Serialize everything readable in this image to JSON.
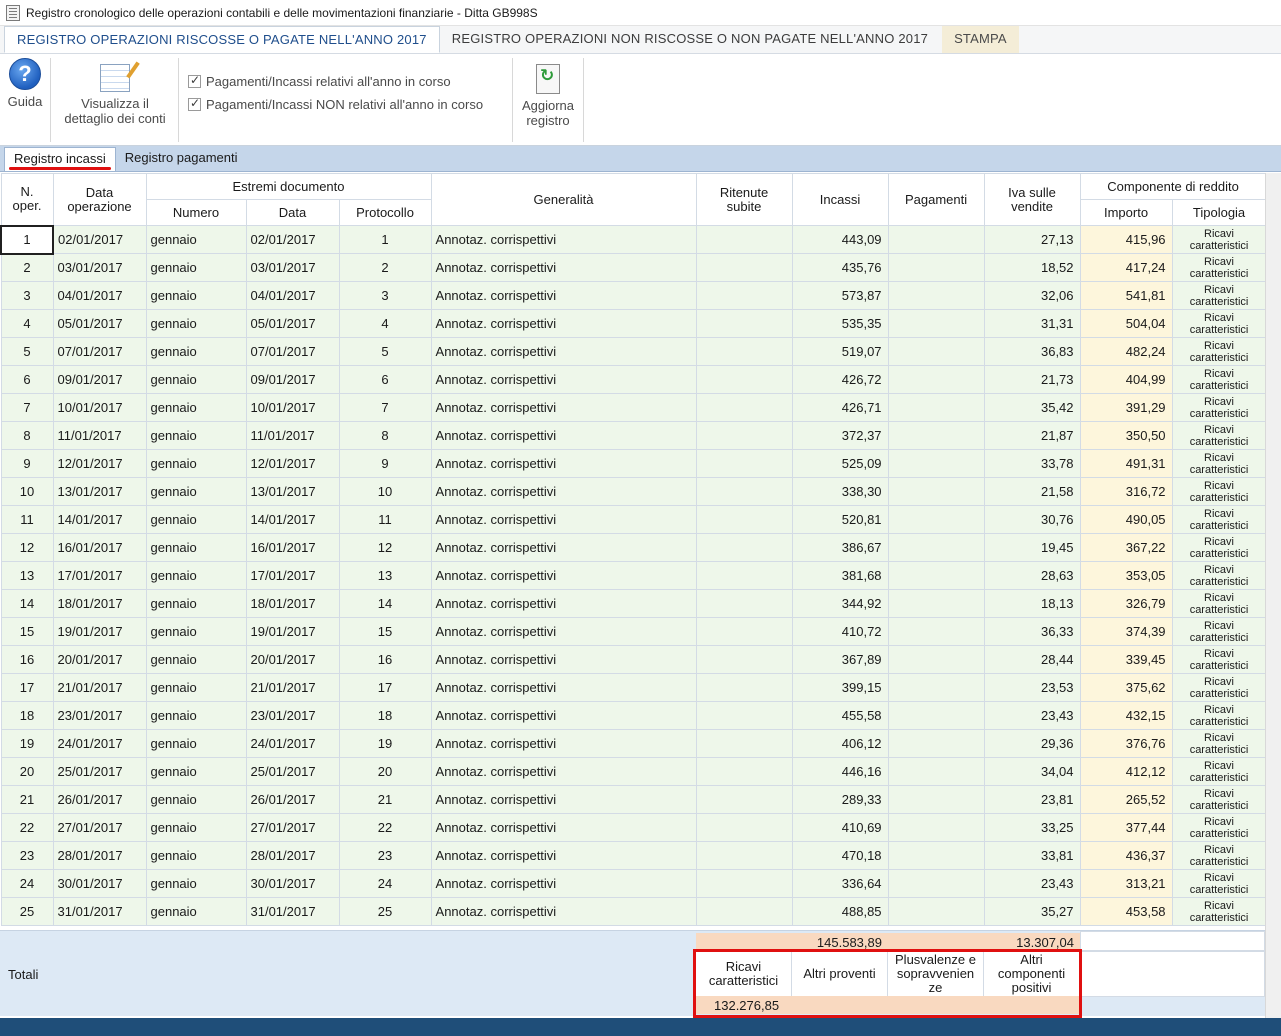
{
  "window": {
    "title": "Registro cronologico delle operazioni contabili e delle movimentazioni finanziarie - Ditta GB998S"
  },
  "ribbon": {
    "tabs": [
      {
        "label": "REGISTRO OPERAZIONI RISCOSSE O PAGATE NELL'ANNO 2017"
      },
      {
        "label": "REGISTRO OPERAZIONI NON RISCOSSE O NON PAGATE NELL'ANNO 2017"
      },
      {
        "label": "STAMPA"
      }
    ]
  },
  "toolbar": {
    "guida": "Guida",
    "visualizza_line1": "Visualizza il",
    "visualizza_line2": "dettaglio dei conti",
    "chk1": "Pagamenti/Incassi relativi all'anno in corso",
    "chk2": "Pagamenti/Incassi NON relativi all'anno in corso",
    "aggiorna_line1": "Aggiorna",
    "aggiorna_line2": "registro"
  },
  "subtabs": [
    {
      "label": "Registro incassi"
    },
    {
      "label": "Registro pagamenti"
    }
  ],
  "grid": {
    "headers": {
      "n_oper": "N.\noper.",
      "data_operazione": "Data\noperazione",
      "estremi": "Estremi documento",
      "numero": "Numero",
      "data": "Data",
      "protocollo": "Protocollo",
      "generalita": "Generalità",
      "ritenute": "Ritenute\nsubite",
      "incassi": "Incassi",
      "pagamenti": "Pagamenti",
      "iva": "Iva sulle\nvendite",
      "componente": "Componente di reddito",
      "importo": "Importo",
      "tipologia": "Tipologia"
    },
    "rows": [
      {
        "n": "1",
        "data_op": "02/01/2017",
        "numero": "gennaio",
        "data": "02/01/2017",
        "prot": "1",
        "gen": "Annotaz. corrispettivi",
        "incassi": "443,09",
        "iva": "27,13",
        "importo": "415,96",
        "tip": "Ricavi caratteristici"
      },
      {
        "n": "2",
        "data_op": "03/01/2017",
        "numero": "gennaio",
        "data": "03/01/2017",
        "prot": "2",
        "gen": "Annotaz. corrispettivi",
        "incassi": "435,76",
        "iva": "18,52",
        "importo": "417,24",
        "tip": "Ricavi caratteristici"
      },
      {
        "n": "3",
        "data_op": "04/01/2017",
        "numero": "gennaio",
        "data": "04/01/2017",
        "prot": "3",
        "gen": "Annotaz. corrispettivi",
        "incassi": "573,87",
        "iva": "32,06",
        "importo": "541,81",
        "tip": "Ricavi caratteristici"
      },
      {
        "n": "4",
        "data_op": "05/01/2017",
        "numero": "gennaio",
        "data": "05/01/2017",
        "prot": "4",
        "gen": "Annotaz. corrispettivi",
        "incassi": "535,35",
        "iva": "31,31",
        "importo": "504,04",
        "tip": "Ricavi caratteristici"
      },
      {
        "n": "5",
        "data_op": "07/01/2017",
        "numero": "gennaio",
        "data": "07/01/2017",
        "prot": "5",
        "gen": "Annotaz. corrispettivi",
        "incassi": "519,07",
        "iva": "36,83",
        "importo": "482,24",
        "tip": "Ricavi caratteristici"
      },
      {
        "n": "6",
        "data_op": "09/01/2017",
        "numero": "gennaio",
        "data": "09/01/2017",
        "prot": "6",
        "gen": "Annotaz. corrispettivi",
        "incassi": "426,72",
        "iva": "21,73",
        "importo": "404,99",
        "tip": "Ricavi caratteristici"
      },
      {
        "n": "7",
        "data_op": "10/01/2017",
        "numero": "gennaio",
        "data": "10/01/2017",
        "prot": "7",
        "gen": "Annotaz. corrispettivi",
        "incassi": "426,71",
        "iva": "35,42",
        "importo": "391,29",
        "tip": "Ricavi caratteristici"
      },
      {
        "n": "8",
        "data_op": "11/01/2017",
        "numero": "gennaio",
        "data": "11/01/2017",
        "prot": "8",
        "gen": "Annotaz. corrispettivi",
        "incassi": "372,37",
        "iva": "21,87",
        "importo": "350,50",
        "tip": "Ricavi caratteristici"
      },
      {
        "n": "9",
        "data_op": "12/01/2017",
        "numero": "gennaio",
        "data": "12/01/2017",
        "prot": "9",
        "gen": "Annotaz. corrispettivi",
        "incassi": "525,09",
        "iva": "33,78",
        "importo": "491,31",
        "tip": "Ricavi caratteristici"
      },
      {
        "n": "10",
        "data_op": "13/01/2017",
        "numero": "gennaio",
        "data": "13/01/2017",
        "prot": "10",
        "gen": "Annotaz. corrispettivi",
        "incassi": "338,30",
        "iva": "21,58",
        "importo": "316,72",
        "tip": "Ricavi caratteristici"
      },
      {
        "n": "11",
        "data_op": "14/01/2017",
        "numero": "gennaio",
        "data": "14/01/2017",
        "prot": "11",
        "gen": "Annotaz. corrispettivi",
        "incassi": "520,81",
        "iva": "30,76",
        "importo": "490,05",
        "tip": "Ricavi caratteristici"
      },
      {
        "n": "12",
        "data_op": "16/01/2017",
        "numero": "gennaio",
        "data": "16/01/2017",
        "prot": "12",
        "gen": "Annotaz. corrispettivi",
        "incassi": "386,67",
        "iva": "19,45",
        "importo": "367,22",
        "tip": "Ricavi caratteristici"
      },
      {
        "n": "13",
        "data_op": "17/01/2017",
        "numero": "gennaio",
        "data": "17/01/2017",
        "prot": "13",
        "gen": "Annotaz. corrispettivi",
        "incassi": "381,68",
        "iva": "28,63",
        "importo": "353,05",
        "tip": "Ricavi caratteristici"
      },
      {
        "n": "14",
        "data_op": "18/01/2017",
        "numero": "gennaio",
        "data": "18/01/2017",
        "prot": "14",
        "gen": "Annotaz. corrispettivi",
        "incassi": "344,92",
        "iva": "18,13",
        "importo": "326,79",
        "tip": "Ricavi caratteristici"
      },
      {
        "n": "15",
        "data_op": "19/01/2017",
        "numero": "gennaio",
        "data": "19/01/2017",
        "prot": "15",
        "gen": "Annotaz. corrispettivi",
        "incassi": "410,72",
        "iva": "36,33",
        "importo": "374,39",
        "tip": "Ricavi caratteristici"
      },
      {
        "n": "16",
        "data_op": "20/01/2017",
        "numero": "gennaio",
        "data": "20/01/2017",
        "prot": "16",
        "gen": "Annotaz. corrispettivi",
        "incassi": "367,89",
        "iva": "28,44",
        "importo": "339,45",
        "tip": "Ricavi caratteristici"
      },
      {
        "n": "17",
        "data_op": "21/01/2017",
        "numero": "gennaio",
        "data": "21/01/2017",
        "prot": "17",
        "gen": "Annotaz. corrispettivi",
        "incassi": "399,15",
        "iva": "23,53",
        "importo": "375,62",
        "tip": "Ricavi caratteristici"
      },
      {
        "n": "18",
        "data_op": "23/01/2017",
        "numero": "gennaio",
        "data": "23/01/2017",
        "prot": "18",
        "gen": "Annotaz. corrispettivi",
        "incassi": "455,58",
        "iva": "23,43",
        "importo": "432,15",
        "tip": "Ricavi caratteristici"
      },
      {
        "n": "19",
        "data_op": "24/01/2017",
        "numero": "gennaio",
        "data": "24/01/2017",
        "prot": "19",
        "gen": "Annotaz. corrispettivi",
        "incassi": "406,12",
        "iva": "29,36",
        "importo": "376,76",
        "tip": "Ricavi caratteristici"
      },
      {
        "n": "20",
        "data_op": "25/01/2017",
        "numero": "gennaio",
        "data": "25/01/2017",
        "prot": "20",
        "gen": "Annotaz. corrispettivi",
        "incassi": "446,16",
        "iva": "34,04",
        "importo": "412,12",
        "tip": "Ricavi caratteristici"
      },
      {
        "n": "21",
        "data_op": "26/01/2017",
        "numero": "gennaio",
        "data": "26/01/2017",
        "prot": "21",
        "gen": "Annotaz. corrispettivi",
        "incassi": "289,33",
        "iva": "23,81",
        "importo": "265,52",
        "tip": "Ricavi caratteristici"
      },
      {
        "n": "22",
        "data_op": "27/01/2017",
        "numero": "gennaio",
        "data": "27/01/2017",
        "prot": "22",
        "gen": "Annotaz. corrispettivi",
        "incassi": "410,69",
        "iva": "33,25",
        "importo": "377,44",
        "tip": "Ricavi caratteristici"
      },
      {
        "n": "23",
        "data_op": "28/01/2017",
        "numero": "gennaio",
        "data": "28/01/2017",
        "prot": "23",
        "gen": "Annotaz. corrispettivi",
        "incassi": "470,18",
        "iva": "33,81",
        "importo": "436,37",
        "tip": "Ricavi caratteristici"
      },
      {
        "n": "24",
        "data_op": "30/01/2017",
        "numero": "gennaio",
        "data": "30/01/2017",
        "prot": "24",
        "gen": "Annotaz. corrispettivi",
        "incassi": "336,64",
        "iva": "23,43",
        "importo": "313,21",
        "tip": "Ricavi caratteristici"
      },
      {
        "n": "25",
        "data_op": "31/01/2017",
        "numero": "gennaio",
        "data": "31/01/2017",
        "prot": "25",
        "gen": "Annotaz. corrispettivi",
        "incassi": "488,85",
        "iva": "35,27",
        "importo": "453,58",
        "tip": "Ricavi caratteristici"
      }
    ]
  },
  "totals": {
    "label": "Totali",
    "incassi": "145.583,89",
    "iva": "13.307,04",
    "summary_headers": [
      "Ricavi\ncaratteristici",
      "Altri proventi",
      "Plusvalenze e\nsopravvenien\nze",
      "Altri\ncomponenti\npositivi"
    ],
    "ricavi_caratteristici": "132.276,85"
  },
  "colors": {
    "row_green": "#eef7ea",
    "importo_cream": "#fdf6dc",
    "totals_peach": "#f9d9c0",
    "highlight_red": "#e01010",
    "subtab_bar": "#c5d6ea"
  }
}
